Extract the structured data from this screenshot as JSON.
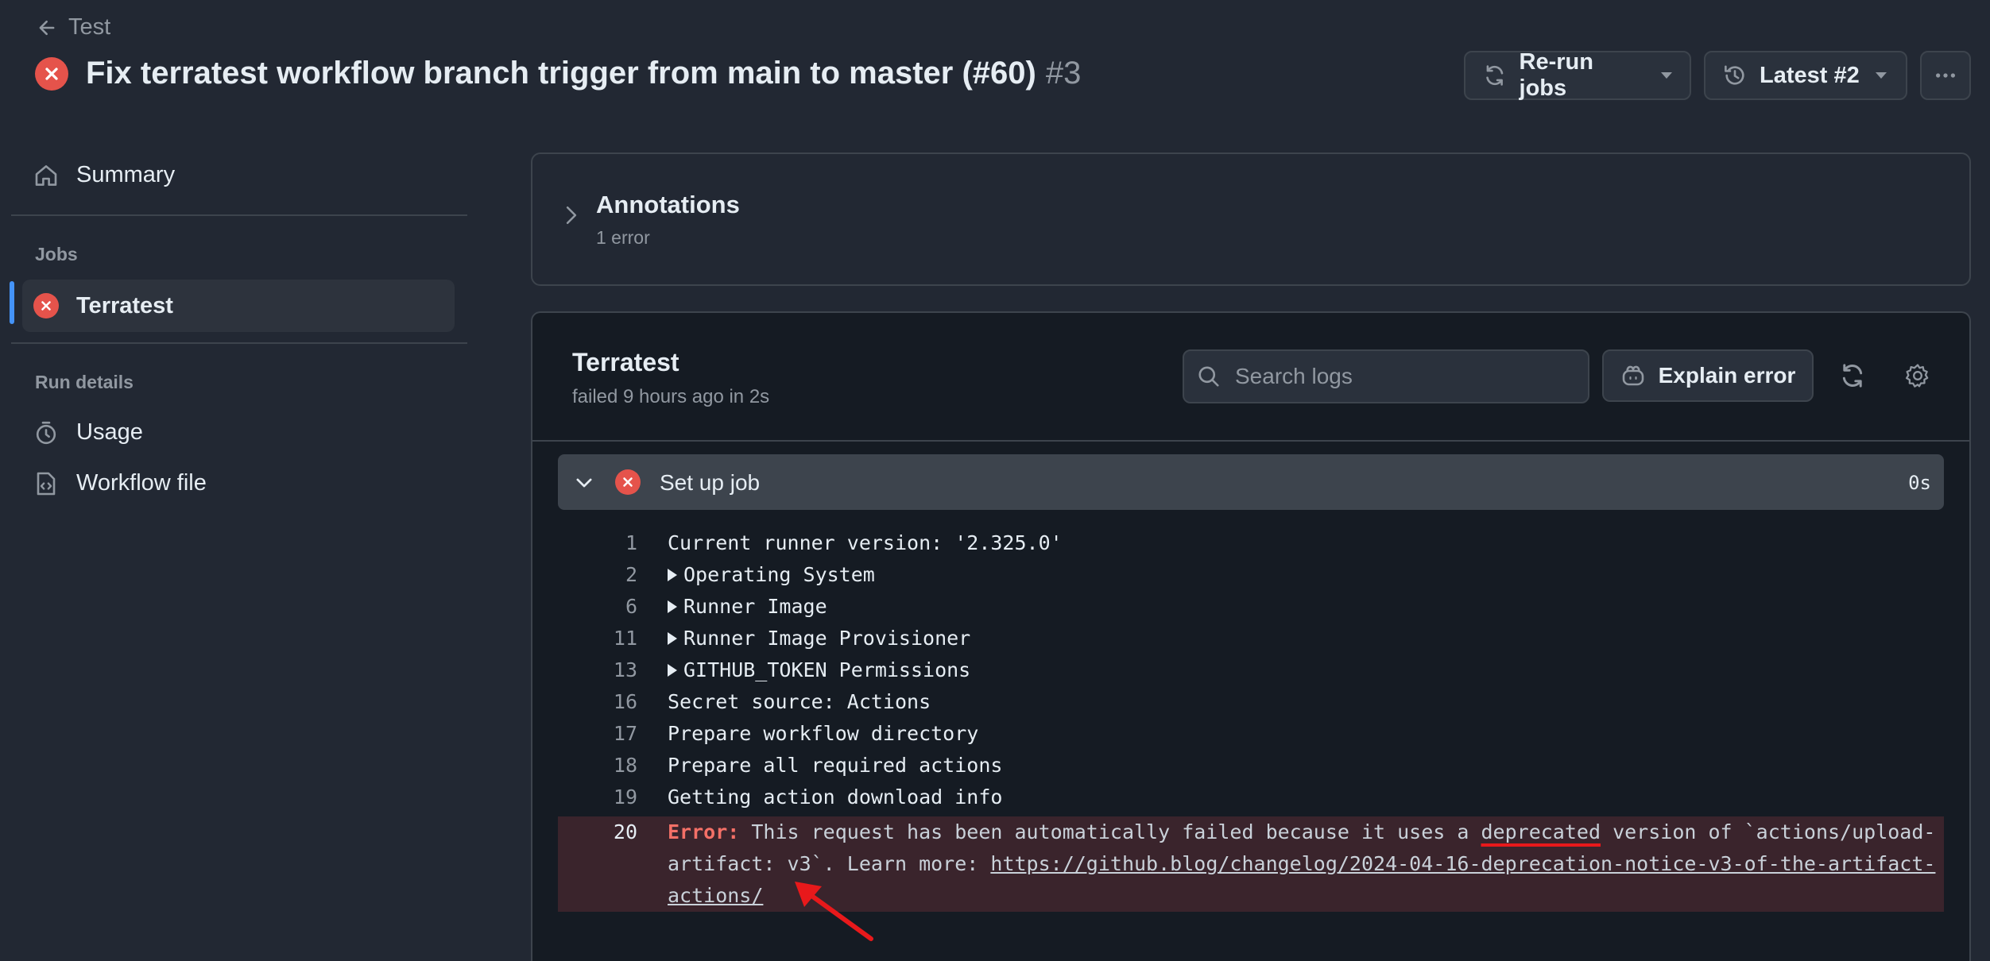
{
  "header": {
    "back_label": "Test",
    "title": "Fix terratest workflow branch trigger from main to master (#60)",
    "run_number": "#3",
    "rerun_label": "Re-run jobs",
    "latest_label": "Latest #2"
  },
  "sidebar": {
    "summary_label": "Summary",
    "jobs_heading": "Jobs",
    "job_label": "Terratest",
    "run_details_heading": "Run details",
    "usage_label": "Usage",
    "workflow_file_label": "Workflow file"
  },
  "annotations": {
    "title": "Annotations",
    "subtitle": "1 error"
  },
  "job": {
    "title": "Terratest",
    "subtitle": "failed 9 hours ago in 2s",
    "search_placeholder": "Search logs",
    "explain_label": "Explain error"
  },
  "step": {
    "name": "Set up job",
    "duration": "0s"
  },
  "log": {
    "lines": [
      {
        "num": "1",
        "text": "Current runner version: '2.325.0'"
      },
      {
        "num": "2",
        "text": "Operating System"
      },
      {
        "num": "6",
        "text": "Runner Image"
      },
      {
        "num": "11",
        "text": "Runner Image Provisioner"
      },
      {
        "num": "13",
        "text": "GITHUB_TOKEN Permissions"
      },
      {
        "num": "16",
        "text": "Secret source: Actions"
      },
      {
        "num": "17",
        "text": "Prepare workflow directory"
      },
      {
        "num": "18",
        "text": "Prepare all required actions"
      },
      {
        "num": "19",
        "text": "Getting action download info"
      }
    ],
    "error": {
      "num": "20",
      "prefix": "Error:",
      "part1": " This request has been automatically failed because it uses a ",
      "highlight": "deprecated",
      "part2": " version of `actions/upload-",
      "part3": "artifact: v3`. Learn more: ",
      "link1": "https://github.blog/changelog/2024-04-16-deprecation-notice-v3-of-the-artifact-",
      "link2": "actions/"
    }
  },
  "colors": {
    "background": "#222833",
    "error": "#e5534b",
    "accent": "#4493f8",
    "annotation_arrow": "#e8191b"
  }
}
